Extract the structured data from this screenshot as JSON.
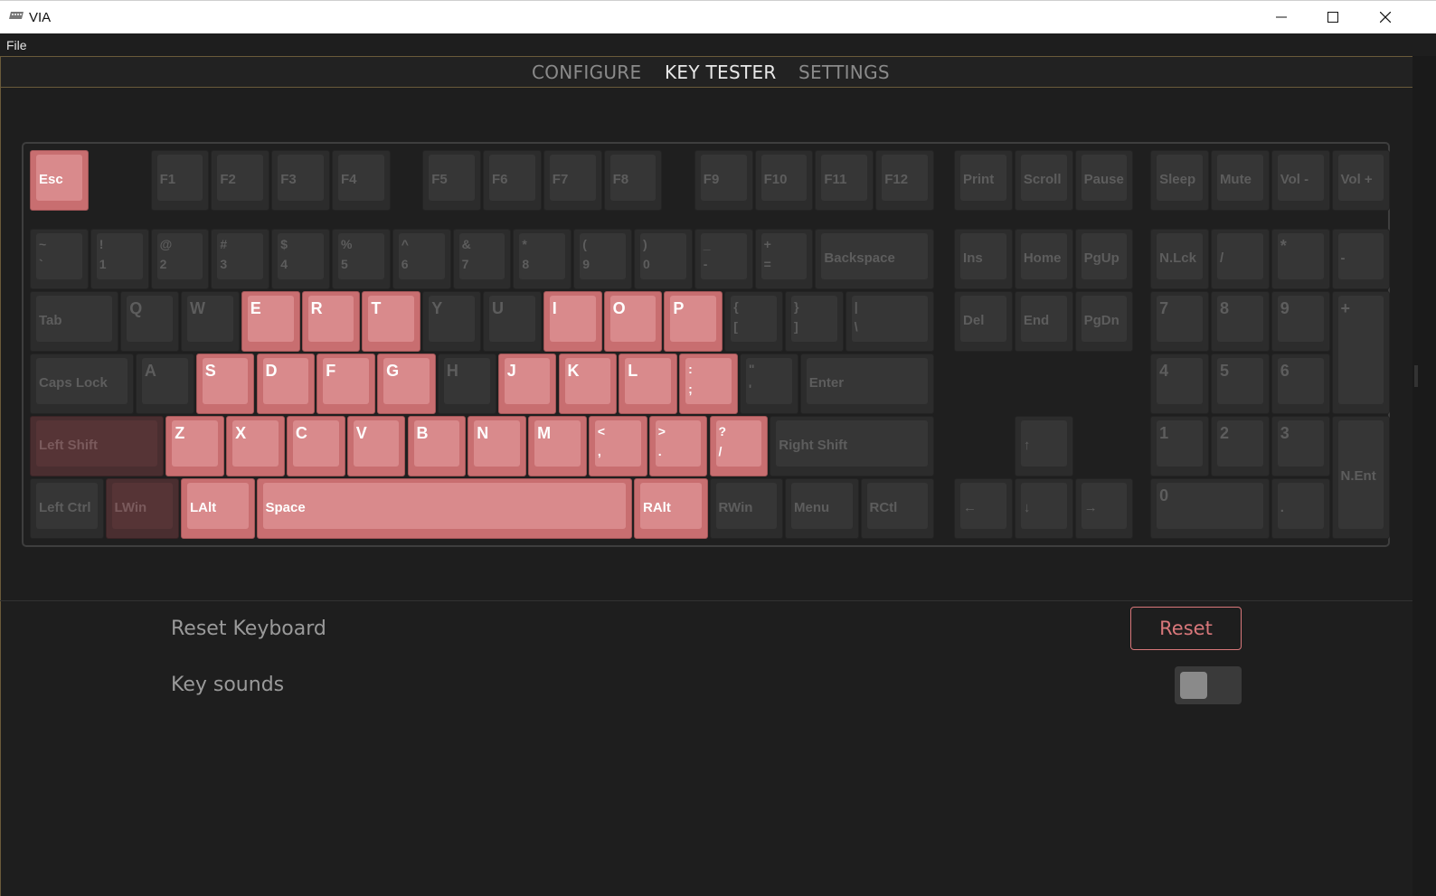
{
  "window": {
    "title": "VIA",
    "minimize": "minimize",
    "maximize": "maximize",
    "close": "close"
  },
  "menu": {
    "file": "File"
  },
  "tabs": [
    {
      "label": "CONFIGURE",
      "active": false
    },
    {
      "label": "KEY TESTER",
      "active": true
    },
    {
      "label": "SETTINGS",
      "active": false
    }
  ],
  "colors": {
    "pressed": "#d98a8c",
    "accent": "#d8777a",
    "border": "#6a5a3a"
  },
  "keys": [
    {
      "id": "esc",
      "l": "Esc",
      "s": "pressed"
    },
    {
      "id": "f1",
      "l": "F1"
    },
    {
      "id": "f2",
      "l": "F2"
    },
    {
      "id": "f3",
      "l": "F3"
    },
    {
      "id": "f4",
      "l": "F4"
    },
    {
      "id": "f5",
      "l": "F5"
    },
    {
      "id": "f6",
      "l": "F6"
    },
    {
      "id": "f7",
      "l": "F7"
    },
    {
      "id": "f8",
      "l": "F8"
    },
    {
      "id": "f9",
      "l": "F9"
    },
    {
      "id": "f10",
      "l": "F10"
    },
    {
      "id": "f11",
      "l": "F11"
    },
    {
      "id": "f12",
      "l": "F12"
    },
    {
      "id": "print",
      "l": "Print"
    },
    {
      "id": "scroll",
      "l": "Scroll"
    },
    {
      "id": "pause",
      "l": "Pause"
    },
    {
      "id": "sleep",
      "l": "Sleep"
    },
    {
      "id": "mute",
      "l": "Mute"
    },
    {
      "id": "voldown",
      "l": "Vol -"
    },
    {
      "id": "volup",
      "l": "Vol +"
    },
    {
      "id": "grave",
      "t": "~",
      "b": "`"
    },
    {
      "id": "1",
      "t": "!",
      "b": "1"
    },
    {
      "id": "2",
      "t": "@",
      "b": "2"
    },
    {
      "id": "3",
      "t": "#",
      "b": "3"
    },
    {
      "id": "4",
      "t": "$",
      "b": "4"
    },
    {
      "id": "5",
      "t": "%",
      "b": "5"
    },
    {
      "id": "6",
      "t": "^",
      "b": "6"
    },
    {
      "id": "7",
      "t": "&",
      "b": "7"
    },
    {
      "id": "8",
      "t": "*",
      "b": "8"
    },
    {
      "id": "9",
      "t": "(",
      "b": "9"
    },
    {
      "id": "0",
      "t": ")",
      "b": "0"
    },
    {
      "id": "minus",
      "t": "_",
      "b": "-"
    },
    {
      "id": "equal",
      "t": "+",
      "b": "="
    },
    {
      "id": "backspace",
      "l": "Backspace"
    },
    {
      "id": "ins",
      "l": "Ins"
    },
    {
      "id": "home",
      "l": "Home"
    },
    {
      "id": "pgup",
      "l": "PgUp"
    },
    {
      "id": "nlck",
      "l": "N.Lck"
    },
    {
      "id": "kpslash",
      "l": "/"
    },
    {
      "id": "kpstar",
      "l": "*",
      "big": true
    },
    {
      "id": "kpminus",
      "l": "-"
    },
    {
      "id": "tab",
      "l": "Tab"
    },
    {
      "id": "q",
      "l": "Q",
      "big": true
    },
    {
      "id": "w",
      "l": "W",
      "big": true
    },
    {
      "id": "e",
      "l": "E",
      "big": true,
      "s": "pressed"
    },
    {
      "id": "r",
      "l": "R",
      "big": true,
      "s": "pressed"
    },
    {
      "id": "t",
      "l": "T",
      "big": true,
      "s": "pressed"
    },
    {
      "id": "y",
      "l": "Y",
      "big": true
    },
    {
      "id": "u",
      "l": "U",
      "big": true
    },
    {
      "id": "i",
      "l": "I",
      "big": true,
      "s": "pressed"
    },
    {
      "id": "o",
      "l": "O",
      "big": true,
      "s": "pressed"
    },
    {
      "id": "p",
      "l": "P",
      "big": true,
      "s": "pressed"
    },
    {
      "id": "lbracket",
      "t": "{",
      "b": "["
    },
    {
      "id": "rbracket",
      "t": "}",
      "b": "]"
    },
    {
      "id": "backslash",
      "t": "|",
      "b": "\\"
    },
    {
      "id": "del",
      "l": "Del"
    },
    {
      "id": "end",
      "l": "End"
    },
    {
      "id": "pgdn",
      "l": "PgDn"
    },
    {
      "id": "kp7",
      "l": "7",
      "big": true
    },
    {
      "id": "kp8",
      "l": "8",
      "big": true
    },
    {
      "id": "kp9",
      "l": "9",
      "big": true
    },
    {
      "id": "kpplus",
      "l": "+",
      "big": true
    },
    {
      "id": "caps",
      "l": "Caps Lock"
    },
    {
      "id": "a",
      "l": "A",
      "big": true
    },
    {
      "id": "s",
      "l": "S",
      "big": true,
      "s": "pressed"
    },
    {
      "id": "d",
      "l": "D",
      "big": true,
      "s": "pressed"
    },
    {
      "id": "f",
      "l": "F",
      "big": true,
      "s": "pressed"
    },
    {
      "id": "g",
      "l": "G",
      "big": true,
      "s": "pressed"
    },
    {
      "id": "h",
      "l": "H",
      "big": true
    },
    {
      "id": "j",
      "l": "J",
      "big": true,
      "s": "pressed"
    },
    {
      "id": "k",
      "l": "K",
      "big": true,
      "s": "pressed"
    },
    {
      "id": "l",
      "l": "L",
      "big": true,
      "s": "pressed"
    },
    {
      "id": "semicolon",
      "t": ":",
      "b": ";",
      "s": "pressed"
    },
    {
      "id": "quote",
      "t": "\"",
      "b": "'"
    },
    {
      "id": "enter",
      "l": "Enter"
    },
    {
      "id": "kp4",
      "l": "4",
      "big": true
    },
    {
      "id": "kp5",
      "l": "5",
      "big": true
    },
    {
      "id": "kp6",
      "l": "6",
      "big": true
    },
    {
      "id": "lshift",
      "l": "Left Shift",
      "s": "half"
    },
    {
      "id": "z",
      "l": "Z",
      "big": true,
      "s": "pressed"
    },
    {
      "id": "x",
      "l": "X",
      "big": true,
      "s": "pressed"
    },
    {
      "id": "c",
      "l": "C",
      "big": true,
      "s": "pressed"
    },
    {
      "id": "v",
      "l": "V",
      "big": true,
      "s": "pressed"
    },
    {
      "id": "b",
      "l": "B",
      "big": true,
      "s": "pressed"
    },
    {
      "id": "n",
      "l": "N",
      "big": true,
      "s": "pressed"
    },
    {
      "id": "m",
      "l": "M",
      "big": true,
      "s": "pressed"
    },
    {
      "id": "comma",
      "t": "<",
      "b": ",",
      "s": "pressed"
    },
    {
      "id": "period",
      "t": ">",
      "b": ".",
      "s": "pressed"
    },
    {
      "id": "slash",
      "t": "?",
      "b": "/",
      "s": "pressed"
    },
    {
      "id": "rshift",
      "l": "Right Shift"
    },
    {
      "id": "up",
      "l": "↑"
    },
    {
      "id": "kp1",
      "l": "1",
      "big": true
    },
    {
      "id": "kp2",
      "l": "2",
      "big": true
    },
    {
      "id": "kp3",
      "l": "3",
      "big": true
    },
    {
      "id": "kpenter",
      "l": "N.Ent"
    },
    {
      "id": "lctrl",
      "l": "Left Ctrl"
    },
    {
      "id": "lwin",
      "l": "LWin",
      "s": "half"
    },
    {
      "id": "lalt",
      "l": "LAlt",
      "s": "pressed"
    },
    {
      "id": "space",
      "l": "Space",
      "s": "pressed"
    },
    {
      "id": "ralt",
      "l": "RAlt",
      "s": "pressed"
    },
    {
      "id": "rwin",
      "l": "RWin"
    },
    {
      "id": "menu",
      "l": "Menu"
    },
    {
      "id": "rctl",
      "l": "RCtl"
    },
    {
      "id": "left",
      "l": "←"
    },
    {
      "id": "down",
      "l": "↓"
    },
    {
      "id": "right",
      "l": "→"
    },
    {
      "id": "kp0",
      "l": "0",
      "big": true
    },
    {
      "id": "kpdot",
      "l": "."
    }
  ],
  "settings": {
    "reset_label": "Reset Keyboard",
    "reset_button": "Reset",
    "sounds_label": "Key sounds",
    "sounds_enabled": false
  }
}
